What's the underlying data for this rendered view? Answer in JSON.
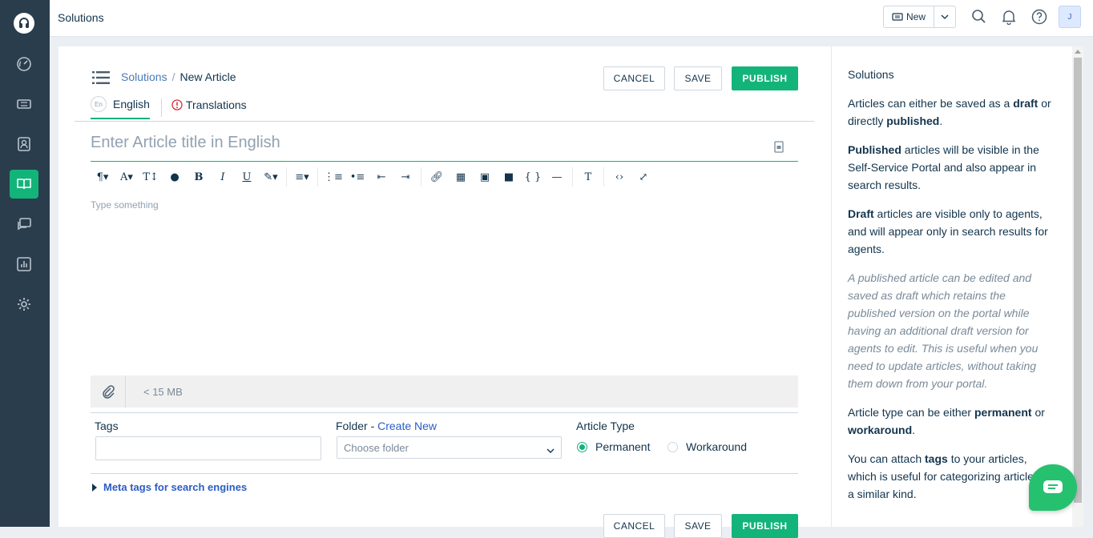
{
  "app": {
    "title": "Solutions"
  },
  "topbar": {
    "new_label": "New",
    "avatar_initial": "J"
  },
  "breadcrumb": {
    "parent": "Solutions",
    "separator": "/",
    "current": "New Article"
  },
  "actions": {
    "cancel": "CANCEL",
    "save": "SAVE",
    "publish": "PUBLISH"
  },
  "tabs": {
    "lang_badge": "En",
    "english": "English",
    "translations": "Translations"
  },
  "editor": {
    "title_placeholder": "Enter Article title in English",
    "body_placeholder": "Type something"
  },
  "attachment": {
    "limit": "< 15 MB"
  },
  "form": {
    "tags_label": "Tags",
    "folder_label": "Folder - ",
    "folder_create": "Create New",
    "folder_placeholder": "Choose folder",
    "type_label": "Article Type",
    "type_options": [
      "Permanent",
      "Workaround"
    ],
    "type_selected": "Permanent",
    "meta_label": "Meta tags for search engines"
  },
  "help": {
    "heading": "Solutions",
    "p1_a": "Articles can either be saved as a ",
    "p1_b": "draft",
    "p1_c": " or directly ",
    "p1_d": "published",
    "p1_e": ".",
    "p2_a": "Published",
    "p2_b": " articles will be visible in the Self-Service Portal and also appear in search results.",
    "p3_a": "Draft",
    "p3_b": " articles are visible only to agents, and will appear only in search results for agents.",
    "p4": "A published article can be edited and saved as draft which retains the published version on the portal while having an additional draft version for agents to edit. This is useful when you need to update articles, without taking them down from your portal.",
    "p5_a": "Article type can be either ",
    "p5_b": "permanent",
    "p5_c": " or ",
    "p5_d": "workaround",
    "p5_e": ".",
    "p6_a": "You can attach ",
    "p6_b": "tags",
    "p6_c": " to your articles, which is useful for categorizing articles of a similar kind."
  },
  "colors": {
    "sidebar": "#2a3d4d",
    "accent": "#13b47a",
    "link": "#2c5cc5"
  }
}
